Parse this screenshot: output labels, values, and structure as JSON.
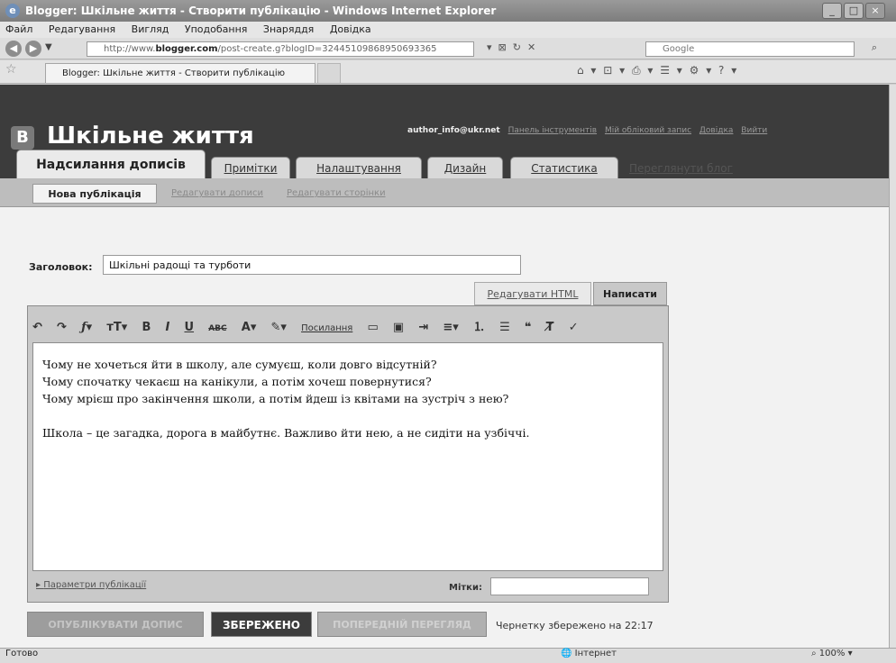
{
  "window": {
    "title": "Blogger: Шкільне життя - Створити публікацію - Windows Internet Explorer",
    "minimize": "_",
    "maximize": "□",
    "close": "×"
  },
  "menubar": [
    "Файл",
    "Редагування",
    "Вигляд",
    "Уподобання",
    "Знаряддя",
    "Довідка"
  ],
  "browser": {
    "address_prefix": "http://www.",
    "address_domain": "blogger.com",
    "address_rest": "/post-create.g?blogID=32445109868950693365",
    "search_placeholder": "Google",
    "tab_title": "Blogger: Шкільне життя - Створити публікацію"
  },
  "header": {
    "logo_letter": "B",
    "blog_title": "Шкільне життя",
    "user_email": "author_info@ukr.net",
    "user_links": [
      "Панель інструментів",
      "Мій обліковий запис",
      "Довідка",
      "Вийти"
    ]
  },
  "tabs": {
    "posting": "Надсилання дописів",
    "comments": "Примітки",
    "settings": "Налаштування",
    "design": "Дизайн",
    "stats": "Статистика",
    "view_blog": "Переглянути блог"
  },
  "subnav": {
    "new_post": "Нова публікація",
    "edit_posts": "Редагувати дописи",
    "edit_pages": "Редагувати сторінки"
  },
  "editor": {
    "title_label": "Заголовок:",
    "title_value": "Шкільні радощі та турботи",
    "mode_html": "Редагувати HTML",
    "mode_compose": "Написати",
    "toolbar_link": "Посилання",
    "body_lines": [
      "Чому не хочеться йти в школу, але сумуєш, коли довго відсутній?",
      "Чому спочатку чекаєш на канікули, а потім хочеш повернутися?",
      "Чому мрієш про закінчення школи, а потім йдеш із квітами на зустріч з нею?"
    ],
    "body_paragraph2": "Школа – це загадка, дорога в майбутнє. Важливо йти нею, а не сидіти на узбіччі.",
    "options_link": "Параметри публікації",
    "labels_label": "Мітки:",
    "labels_value": ""
  },
  "actions": {
    "publish": "ОПУБЛІКУВАТИ ДОПИС",
    "saved": "ЗБЕРЕЖЕНО",
    "preview": "ПОПЕРЕДНІЙ ПЕРЕГЛЯД",
    "draft_status": "Чернетку збережено на 22:17"
  },
  "statusbar": {
    "text": "Готово",
    "zone": "Інтернет",
    "zoom": "100%"
  }
}
